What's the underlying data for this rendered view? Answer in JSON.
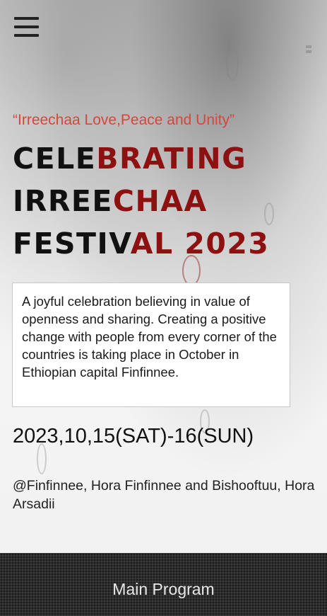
{
  "header": {
    "menu_icon": "hamburger-menu-icon"
  },
  "hero": {
    "tagline": "“Irreechaa Love,Peace and Unity”",
    "title_lines": [
      [
        "CELE",
        "BRATING"
      ],
      [
        "IRREE",
        "CHAA"
      ],
      [
        "FESTIV",
        "AL 2023"
      ]
    ],
    "description": "A joyful celebration believing in value of openness and sharing. Creating a positive change with people from every corner of the countries is taking place in October in Ethiopian capital Finfinnee.",
    "date": "2023,10,15(SAT)-16(SUN)",
    "venue": "@Finfinnee, Hora Finfinnee and Bishooftuu, Hora Arsadii"
  },
  "footer": {
    "main_program_label": "Main Program"
  },
  "colors": {
    "tagline": "#d9453a",
    "title_dark": "#111111",
    "title_red": "#8e1111",
    "footer_bg": "#2e2e2e"
  }
}
